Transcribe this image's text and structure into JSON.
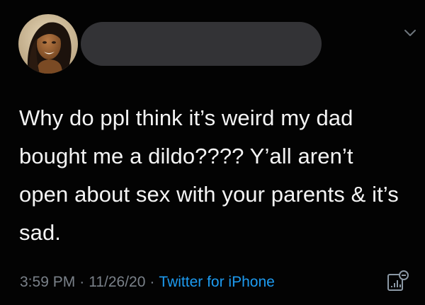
{
  "tweet": {
    "text": "Why do ppl think it’s weird my dad bought me a dildo???? Y’all aren’t open about sex with your parents & it’s sad.",
    "time": "3:59 PM",
    "separator": "·",
    "date": "11/26/20",
    "source": "Twitter for iPhone"
  },
  "icons": {
    "more": "chevron-down-icon",
    "analytics": "analytics-icon"
  },
  "colors": {
    "background": "#030303",
    "text": "#f4f4f4",
    "meta": "#7a8189",
    "link": "#1d9bf0",
    "redaction": "#333336"
  }
}
